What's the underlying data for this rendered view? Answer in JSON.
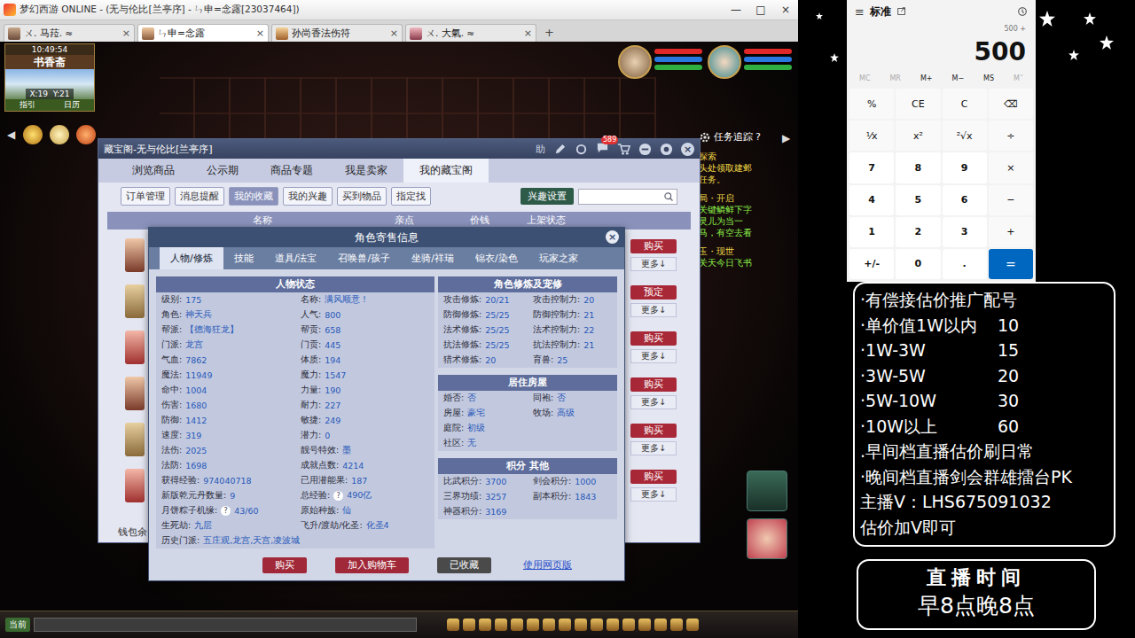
{
  "window": {
    "title": "梦幻西游 ONLINE - (无与伦比[兰亭序] - ㄣ申=念露[23037464])",
    "controls": [
      "—",
      "□",
      "×"
    ]
  },
  "browser_tabs": [
    {
      "label": "ㄨ. 马菈. ≈",
      "selected": false,
      "close": "×"
    },
    {
      "label": "ㄣ申=念露",
      "selected": true,
      "close": "×"
    },
    {
      "label": "孙尚香法伤符",
      "selected": false,
      "close": "×"
    },
    {
      "label": "ㄨ. 大氣. ≈",
      "selected": false,
      "close": "×"
    }
  ],
  "new_tab": "+",
  "minimap": {
    "time": "10:49:54",
    "place": "书香斋",
    "coords": "X:19  Y:21",
    "buttons": [
      "指引",
      "日历"
    ]
  },
  "nav_arrows": [
    "◀",
    "▶"
  ],
  "task_tracker": {
    "title": "任务追踪",
    "help": "?",
    "lines": [
      {
        "text": "探索",
        "kind": "head",
        "color": "#f0d848"
      },
      {
        "text": "头处领取建邺",
        "kind": "body",
        "color": "#f0d848"
      },
      {
        "text": "任务。",
        "kind": "body",
        "color": "#f0d848"
      },
      {
        "text": "局・开启",
        "kind": "head",
        "color": "#f0d848"
      },
      {
        "text": "关键鳞鲜下字",
        "kind": "body",
        "color": "#8ef04a"
      },
      {
        "text": "灵儿为当一",
        "kind": "body",
        "color": "#8ef04a"
      },
      {
        "text": "马，有空去看",
        "kind": "body",
        "color": "#8ef04a"
      },
      {
        "text": "玉・现世",
        "kind": "head",
        "color": "#f0d848"
      },
      {
        "text": "关天今日飞书",
        "kind": "body",
        "color": "#8ef04a"
      }
    ]
  },
  "shop": {
    "title": "藏宝阁-无与伦比[兰亭序]",
    "help": "助",
    "badge": "589",
    "close": "×",
    "tabs": [
      {
        "label": "浏览商品",
        "selected": false
      },
      {
        "label": "公示期",
        "selected": false
      },
      {
        "label": "商品专题",
        "selected": false
      },
      {
        "label": "我是卖家",
        "selected": false
      },
      {
        "label": "我的藏宝阁",
        "selected": true
      }
    ],
    "subtabs": [
      {
        "label": "订单管理",
        "selected": false
      },
      {
        "label": "消息提醒",
        "selected": false
      },
      {
        "label": "我的收藏",
        "selected": true
      },
      {
        "label": "我的兴趣",
        "selected": false
      },
      {
        "label": "买到物品",
        "selected": false
      },
      {
        "label": "指定找",
        "selected": false
      }
    ],
    "settings": "兴趣设置",
    "columns": [
      "名称",
      "亲点",
      "价钱",
      "上架状态"
    ],
    "rows": [
      {
        "action": "购买",
        "more": "更多↓"
      },
      {
        "action": "预定",
        "more": "更多↓"
      },
      {
        "action": "购买",
        "more": "更多↓"
      },
      {
        "action": "购买",
        "more": "更多↓"
      },
      {
        "action": "购买",
        "more": "更多↓"
      },
      {
        "action": "购买",
        "more": "更多↓"
      }
    ],
    "footer": "钱包余"
  },
  "dialog": {
    "title": "角色寄售信息",
    "close": "×",
    "tabs": [
      {
        "label": "人物/修炼",
        "selected": true
      },
      {
        "label": "技能",
        "selected": false
      },
      {
        "label": "道具/法宝",
        "selected": false
      },
      {
        "label": "召唤兽/孩子",
        "selected": false
      },
      {
        "label": "坐骑/祥瑞",
        "selected": false
      },
      {
        "label": "锦衣/染色",
        "selected": false
      },
      {
        "label": "玩家之家",
        "selected": false
      }
    ],
    "status": {
      "title": "人物状态",
      "rows": [
        [
          {
            "label": "级别:",
            "value": "175"
          },
          {
            "label": "名称:",
            "value": "满风顺意！"
          }
        ],
        [
          {
            "label": "角色:",
            "value": "神天兵"
          },
          {
            "label": "人气:",
            "value": "800"
          }
        ],
        [
          {
            "label": "帮派:",
            "value": "【德海狂龙】"
          },
          {
            "label": "帮贡:",
            "value": "658"
          }
        ],
        [
          {
            "label": "门派:",
            "value": "龙宫"
          },
          {
            "label": "门贡:",
            "value": "445"
          }
        ],
        [
          {
            "label": "气血:",
            "value": "7862"
          },
          {
            "label": "体质:",
            "value": "194"
          }
        ],
        [
          {
            "label": "魔法:",
            "value": "11949"
          },
          {
            "label": "魔力:",
            "value": "1547"
          }
        ],
        [
          {
            "label": "命中:",
            "value": "1004"
          },
          {
            "label": "力量:",
            "value": "190"
          }
        ],
        [
          {
            "label": "伤害:",
            "value": "1680"
          },
          {
            "label": "耐力:",
            "value": "227"
          }
        ],
        [
          {
            "label": "防御:",
            "value": "1412"
          },
          {
            "label": "敏捷:",
            "value": "249"
          }
        ],
        [
          {
            "label": "速度:",
            "value": "319"
          },
          {
            "label": "潜力:",
            "value": "0"
          }
        ],
        [
          {
            "label": "法伤:",
            "value": "2025"
          },
          {
            "label": "靓号特效:",
            "value": "墨"
          }
        ],
        [
          {
            "label": "法防:",
            "value": "1698"
          },
          {
            "label": "成就点数:",
            "value": "4214"
          }
        ],
        [
          {
            "label": "获得经验:",
            "value": "974040718"
          },
          {
            "label": "已用潜能果:",
            "value": "187"
          }
        ],
        [
          {
            "label": "新版乾元丹数量:",
            "value": "9"
          },
          {
            "label": "总经验:",
            "value": "490亿",
            "help": "?"
          }
        ],
        [
          {
            "label": "月饼粽子机缘:",
            "value": "43/60",
            "help": "?"
          },
          {
            "label": "原始种族:",
            "value": "仙"
          }
        ],
        [
          {
            "label": "生死劫:",
            "value": "九层"
          },
          {
            "label": "飞升/渡劫/化圣:",
            "value": "化圣4"
          }
        ]
      ],
      "history": {
        "label": "历史门派:",
        "value": "五庄观,龙宫,天宫,凌波城"
      }
    },
    "cultivation": {
      "title": "角色修炼及宠修",
      "rows": [
        [
          {
            "label": "攻击修炼:",
            "value": "20/21"
          },
          {
            "label": "攻击控制力:",
            "value": "20"
          }
        ],
        [
          {
            "label": "防御修炼:",
            "value": "25/25"
          },
          {
            "label": "防御控制力:",
            "value": "21"
          }
        ],
        [
          {
            "label": "法术修炼:",
            "value": "25/25"
          },
          {
            "label": "法术控制力:",
            "value": "22"
          }
        ],
        [
          {
            "label": "抗法修炼:",
            "value": "25/25"
          },
          {
            "label": "抗法控制力:",
            "value": "21"
          }
        ],
        [
          {
            "label": "猎术修炼:",
            "value": "20"
          },
          {
            "label": "育兽:",
            "value": "25"
          }
        ]
      ]
    },
    "housing": {
      "title": "居住房屋",
      "rows": [
        [
          {
            "label": "婚否:",
            "value": "否"
          },
          {
            "label": "同袍:",
            "value": "否"
          }
        ],
        [
          {
            "label": "房屋:",
            "value": "豪宅"
          },
          {
            "label": "牧场:",
            "value": "高级"
          }
        ],
        [
          {
            "label": "庭院:",
            "value": "初级"
          }
        ],
        [
          {
            "label": "社区:",
            "value": "无"
          }
        ]
      ]
    },
    "scores": {
      "title": "积分 其他",
      "rows": [
        [
          {
            "label": "比武积分:",
            "value": "3700"
          },
          {
            "label": "剑会积分:",
            "value": "1000"
          }
        ],
        [
          {
            "label": "三界功绩:",
            "value": "3257"
          },
          {
            "label": "副本积分:",
            "value": "1843"
          }
        ],
        [
          {
            "label": "神器积分:",
            "value": "3169"
          }
        ]
      ]
    },
    "actions": [
      {
        "label": "购买",
        "kind": "primary"
      },
      {
        "label": "加入购物车",
        "kind": "primary"
      },
      {
        "label": "已收藏",
        "kind": "done"
      },
      {
        "label": "使用网页版",
        "kind": "link"
      }
    ]
  },
  "chat": {
    "channel": "当前"
  },
  "calculator": {
    "menu": "≡",
    "title": "标准",
    "expression": "500 +",
    "display": "500",
    "memory": [
      {
        "label": "MC",
        "disabled": true
      },
      {
        "label": "MR",
        "disabled": true
      },
      {
        "label": "M+",
        "disabled": false
      },
      {
        "label": "M−",
        "disabled": false
      },
      {
        "label": "MS",
        "disabled": false
      },
      {
        "label": "M˅",
        "disabled": true
      }
    ],
    "keys": [
      {
        "label": "%",
        "kind": "op"
      },
      {
        "label": "CE",
        "kind": "op"
      },
      {
        "label": "C",
        "kind": "op"
      },
      {
        "label": "⌫",
        "kind": "op"
      },
      {
        "label": "⅟x",
        "kind": "op"
      },
      {
        "label": "x²",
        "kind": "op"
      },
      {
        "label": "²√x",
        "kind": "op"
      },
      {
        "label": "÷",
        "kind": "op"
      },
      {
        "label": "7",
        "kind": "num"
      },
      {
        "label": "8",
        "kind": "num"
      },
      {
        "label": "9",
        "kind": "num"
      },
      {
        "label": "×",
        "kind": "op"
      },
      {
        "label": "4",
        "kind": "num"
      },
      {
        "label": "5",
        "kind": "num"
      },
      {
        "label": "6",
        "kind": "num"
      },
      {
        "label": "−",
        "kind": "op"
      },
      {
        "label": "1",
        "kind": "num"
      },
      {
        "label": "2",
        "kind": "num"
      },
      {
        "label": "3",
        "kind": "num"
      },
      {
        "label": "+",
        "kind": "op"
      },
      {
        "label": "+/-",
        "kind": "num"
      },
      {
        "label": "0",
        "kind": "num"
      },
      {
        "label": ".",
        "kind": "num"
      },
      {
        "label": "=",
        "kind": "equals"
      }
    ]
  },
  "promo": {
    "lines": [
      {
        "kind": "text",
        "text": "·有偿接估价推广配号"
      },
      {
        "kind": "price",
        "text": "·单价值1W以内",
        "price": "10"
      },
      {
        "kind": "price",
        "text": "·1W-3W",
        "price": "15"
      },
      {
        "kind": "price",
        "text": "·3W-5W",
        "price": "20"
      },
      {
        "kind": "price",
        "text": "·5W-10W",
        "price": "30"
      },
      {
        "kind": "price",
        "text": "·10W以上",
        "price": "60"
      },
      {
        "kind": "text",
        "text": ".早间档直播估价刷日常"
      },
      {
        "kind": "text",
        "text": "·晚间档直播剑会群雄擂台PK"
      },
      {
        "kind": "text",
        "text": "主播V：LHS675091032"
      },
      {
        "kind": "text",
        "text": "估价加V即可"
      }
    ]
  },
  "schedule": {
    "title": "直播时间",
    "hours": "早8点晚8点"
  }
}
